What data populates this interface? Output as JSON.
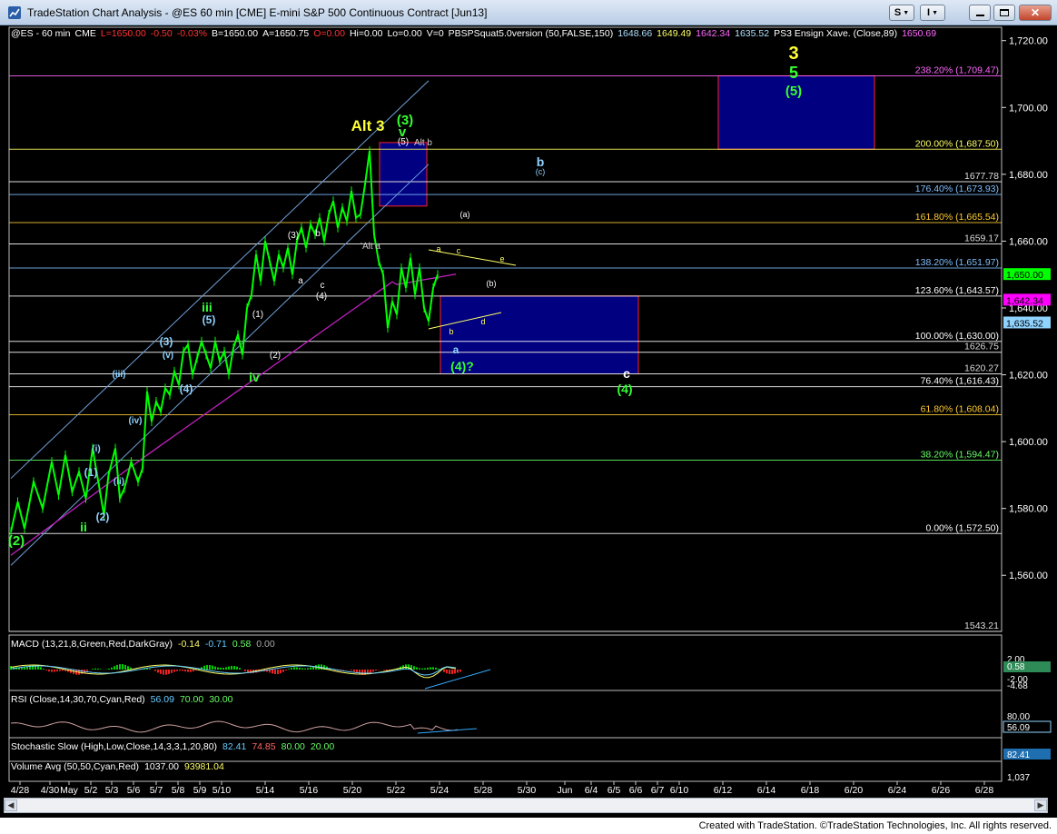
{
  "window": {
    "title": "TradeStation Chart Analysis - @ES 60 min [CME] E-mini S&P 500 Continuous Contract [Jun13]",
    "buttons": [
      "S",
      "I"
    ]
  },
  "footer": "Created with TradeStation. ©TradeStation Technologies, Inc. All rights reserved.",
  "colors": {
    "bg": "#000000",
    "price": "#00ff00",
    "box": "#000080",
    "ma": "#ff00ff",
    "channel": "#6fa0d8"
  },
  "chart_data": {
    "type": "line",
    "symbol_line": [
      {
        "t": "@ES - 60 min",
        "c": "#ffffff"
      },
      {
        "t": "CME",
        "c": "#ffffff"
      },
      {
        "t": "L=1650.00",
        "c": "#ff3333"
      },
      {
        "t": "-0.50",
        "c": "#ff3333"
      },
      {
        "t": "-0.03%",
        "c": "#ff3333"
      },
      {
        "t": "B=1650.00",
        "c": "#ffffff"
      },
      {
        "t": "A=1650.75",
        "c": "#ffffff"
      },
      {
        "t": "O=0.00",
        "c": "#ff3333"
      },
      {
        "t": "Hi=0.00",
        "c": "#ffffff"
      },
      {
        "t": "Lo=0.00",
        "c": "#ffffff"
      },
      {
        "t": "V=0",
        "c": "#ffffff"
      },
      {
        "t": "PBSPSquat5.0version (50,FALSE,150)",
        "c": "#ffffff"
      },
      {
        "t": "1648.66",
        "c": "#aee0ff"
      },
      {
        "t": "1649.49",
        "c": "#ffff66"
      },
      {
        "t": "1642.34",
        "c": "#ff66ff"
      },
      {
        "t": "1635.52",
        "c": "#aee0ff"
      },
      {
        "t": "PS3 Ensign Xave. (Close,89)",
        "c": "#ffffff"
      },
      {
        "t": "1650.69",
        "c": "#ff66ff"
      }
    ],
    "y_ticks": [
      "1,720.00",
      "1,700.00",
      "1,680.00",
      "1,660.00",
      "1,640.00",
      "1,620.00",
      "1,600.00",
      "1,580.00",
      "1,560.00"
    ],
    "y_tick_values": [
      1720,
      1700,
      1680,
      1660,
      1640,
      1620,
      1600,
      1580,
      1560
    ],
    "ylim": [
      1543.21,
      1724
    ],
    "x_labels": [
      "4/28",
      "4/30",
      "May",
      "5/2",
      "5/3",
      "5/6",
      "5/7",
      "5/8",
      "5/9",
      "5/10",
      "5/14",
      "5/16",
      "5/20",
      "5/22",
      "5/24",
      "5/28",
      "5/30",
      "Jun",
      "6/4",
      "6/5",
      "6/6",
      "6/7",
      "6/10",
      "6/12",
      "6/14",
      "6/18",
      "6/20",
      "6/24",
      "6/26",
      "6/28"
    ],
    "fib_levels": [
      {
        "label": "238.20% (1,709.47)",
        "value": 1709.47,
        "color": "#ff66ff"
      },
      {
        "label": "200.00% (1,687.50)",
        "value": 1687.5,
        "color": "#ffff66"
      },
      {
        "label": "176.40% (1,673.93)",
        "value": 1673.93,
        "color": "#7fbfff"
      },
      {
        "label": "161.80% (1,665.54)",
        "value": 1665.54,
        "color": "#ffcc33"
      },
      {
        "label": "138.20% (1,651.97)",
        "value": 1651.97,
        "color": "#7fbfff"
      },
      {
        "label": "123.60% (1,643.57)",
        "value": 1643.57,
        "color": "#ffffff"
      },
      {
        "label": "100.00% (1,630.00)",
        "value": 1630,
        "color": "#ffffff"
      },
      {
        "label": "76.40% (1,616.43)",
        "value": 1616.43,
        "color": "#ffffff"
      },
      {
        "label": "61.80% (1,608.04)",
        "value": 1608.04,
        "color": "#ffcc33"
      },
      {
        "label": "38.20% (1,594.47)",
        "value": 1594.47,
        "color": "#66ff66"
      },
      {
        "label": "0.00% (1,572.50)",
        "value": 1572.5,
        "color": "#ffffff"
      }
    ],
    "hlines": [
      {
        "label": "1677.78",
        "value": 1677.78
      },
      {
        "label": "1659.17",
        "value": 1659.17
      },
      {
        "label": "1626.75",
        "value": 1626.75
      },
      {
        "label": "1620.27",
        "value": 1620.27
      },
      {
        "label": "1543.21",
        "value": 1543.21
      }
    ],
    "price_flags": [
      {
        "label": "1,650.00",
        "value": 1650,
        "bg": "#00ff00",
        "fg": "#000000"
      },
      {
        "label": "1,642.34",
        "value": 1642.34,
        "bg": "#ff00ff",
        "fg": "#000000"
      },
      {
        "label": "1,635.52",
        "value": 1635.52,
        "bg": "#8fd3ff",
        "fg": "#000000"
      }
    ],
    "price_path": [
      [
        0,
        1573
      ],
      [
        3,
        1582
      ],
      [
        6,
        1574
      ],
      [
        10,
        1588
      ],
      [
        14,
        1580
      ],
      [
        18,
        1594
      ],
      [
        21,
        1584
      ],
      [
        24,
        1596
      ],
      [
        27,
        1585
      ],
      [
        30,
        1591
      ],
      [
        33,
        1583
      ],
      [
        36,
        1598
      ],
      [
        39,
        1586
      ],
      [
        41,
        1578
      ],
      [
        43,
        1590
      ],
      [
        46,
        1598
      ],
      [
        48,
        1583
      ],
      [
        50,
        1586
      ],
      [
        53,
        1594
      ],
      [
        56,
        1588
      ],
      [
        58,
        1592
      ],
      [
        60,
        1615
      ],
      [
        62,
        1606
      ],
      [
        64,
        1612
      ],
      [
        66,
        1609
      ],
      [
        68,
        1616
      ],
      [
        70,
        1614
      ],
      [
        72,
        1621
      ],
      [
        74,
        1617
      ],
      [
        76,
        1627
      ],
      [
        78,
        1629
      ],
      [
        80,
        1620
      ],
      [
        82,
        1625
      ],
      [
        84,
        1630
      ],
      [
        86,
        1626
      ],
      [
        88,
        1622
      ],
      [
        90,
        1630
      ],
      [
        92,
        1624
      ],
      [
        94,
        1627
      ],
      [
        96,
        1620
      ],
      [
        98,
        1628
      ],
      [
        100,
        1632
      ],
      [
        102,
        1626
      ],
      [
        104,
        1640
      ],
      [
        106,
        1644
      ],
      [
        108,
        1656
      ],
      [
        110,
        1648
      ],
      [
        112,
        1660
      ],
      [
        114,
        1654
      ],
      [
        116,
        1648
      ],
      [
        118,
        1656
      ],
      [
        120,
        1652
      ],
      [
        122,
        1658
      ],
      [
        124,
        1650
      ],
      [
        126,
        1660
      ],
      [
        128,
        1664
      ],
      [
        130,
        1658
      ],
      [
        132,
        1665
      ],
      [
        134,
        1662
      ],
      [
        136,
        1667
      ],
      [
        138,
        1660
      ],
      [
        140,
        1668
      ],
      [
        142,
        1672
      ],
      [
        144,
        1664
      ],
      [
        146,
        1670
      ],
      [
        148,
        1666
      ],
      [
        150,
        1675
      ],
      [
        152,
        1667
      ],
      [
        154,
        1668
      ],
      [
        156,
        1677
      ],
      [
        158,
        1687
      ],
      [
        160,
        1662
      ],
      [
        162,
        1654
      ],
      [
        164,
        1650
      ],
      [
        166,
        1634
      ],
      [
        168,
        1642
      ],
      [
        170,
        1638
      ],
      [
        172,
        1652
      ],
      [
        174,
        1646
      ],
      [
        176,
        1655
      ],
      [
        178,
        1644
      ],
      [
        180,
        1652
      ],
      [
        182,
        1640
      ],
      [
        184,
        1636
      ],
      [
        186,
        1646
      ],
      [
        188,
        1650
      ]
    ],
    "macd": {
      "label": "MACD (13,21,8,Green,Red,DarkGray)",
      "values": [
        "-0.14",
        "-0.71",
        "0.58",
        "0.00"
      ],
      "value_colors": [
        "#ffff66",
        "#66ccff",
        "#66ff66",
        "#aaaaaa"
      ],
      "ticks": [
        "2.00",
        "0.58",
        "-2.00",
        "-4.68"
      ]
    },
    "rsi": {
      "label": "RSI (Close,14,30,70,Cyan,Red)",
      "values": [
        "56.09",
        "70.00",
        "30.00"
      ],
      "value_colors": [
        "#66ccff",
        "#66ff66",
        "#66ff66"
      ],
      "ticks": [
        "80.00",
        "56.09"
      ]
    },
    "stoch": {
      "label": "Stochastic Slow (High,Low,Close,14,3,3,1,20,80)",
      "values": [
        "82.41",
        "74.85",
        "80.00",
        "20.00"
      ],
      "value_colors": [
        "#66ccff",
        "#ff6666",
        "#66ff66",
        "#66ff66"
      ],
      "ticks": [
        "82.41"
      ]
    },
    "volume": {
      "label": "Volume Avg (50,50,Cyan,Red)",
      "values": [
        "1037.00",
        "93981.04"
      ],
      "value_colors": [
        "#ffffff",
        "#ffff66"
      ],
      "ticks": [
        "1,037"
      ]
    },
    "annotations": [
      {
        "t": "3",
        "c": "#ffff33",
        "s": 20,
        "x": 874,
        "y": 65,
        "b": true
      },
      {
        "t": "5",
        "c": "#33ff33",
        "s": 18,
        "x": 874,
        "y": 86,
        "b": true
      },
      {
        "t": "(5)",
        "c": "#33ff33",
        "s": 15,
        "x": 874,
        "y": 105,
        "b": true
      },
      {
        "t": "Alt 3",
        "c": "#ffff33",
        "s": 17,
        "x": 405,
        "y": 144,
        "b": true
      },
      {
        "t": "(3)",
        "c": "#33ff33",
        "s": 15,
        "x": 446,
        "y": 137,
        "b": true
      },
      {
        "t": "v",
        "c": "#33ff33",
        "s": 15,
        "x": 443,
        "y": 150,
        "b": true
      },
      {
        "t": "(5)",
        "c": "#ffffff",
        "s": 10,
        "x": 444,
        "y": 159,
        "b": false
      },
      {
        "t": "Alt b",
        "c": "#cccccc",
        "s": 10,
        "x": 466,
        "y": 160,
        "b": false
      },
      {
        "t": "b",
        "c": "#8fd3ff",
        "s": 14,
        "x": 595,
        "y": 183,
        "b": true
      },
      {
        "t": "(c)",
        "c": "#8fd3ff",
        "s": 9,
        "x": 595,
        "y": 192,
        "b": false
      },
      {
        "t": "(a)",
        "c": "#ffffff",
        "s": 9,
        "x": 512,
        "y": 239,
        "b": false
      },
      {
        "t": "(b)",
        "c": "#ffffff",
        "s": 9,
        "x": 541,
        "y": 315,
        "b": false
      },
      {
        "t": "a",
        "c": "#ffff66",
        "s": 9,
        "x": 483,
        "y": 277,
        "b": false
      },
      {
        "t": "c",
        "c": "#ffff66",
        "s": 9,
        "x": 505,
        "y": 279,
        "b": false
      },
      {
        "t": "e",
        "c": "#ffff66",
        "s": 9,
        "x": 553,
        "y": 288,
        "b": false
      },
      {
        "t": "d",
        "c": "#ffff66",
        "s": 9,
        "x": 532,
        "y": 357,
        "b": false
      },
      {
        "t": "b",
        "c": "#ffff66",
        "s": 9,
        "x": 497,
        "y": 368,
        "b": false
      },
      {
        "t": "a",
        "c": "#8fd3ff",
        "s": 12,
        "x": 502,
        "y": 389,
        "b": true
      },
      {
        "t": "(4)?",
        "c": "#33ff33",
        "s": 14,
        "x": 509,
        "y": 408,
        "b": true
      },
      {
        "t": "c",
        "c": "#ffffff",
        "s": 14,
        "x": 690,
        "y": 416,
        "b": true
      },
      {
        "t": "(4)",
        "c": "#33ff33",
        "s": 14,
        "x": 688,
        "y": 433,
        "b": true
      },
      {
        "t": "(3)",
        "c": "#ffffff",
        "s": 10,
        "x": 323,
        "y": 262,
        "b": false
      },
      {
        "t": "b",
        "c": "#ffffff",
        "s": 10,
        "x": 350,
        "y": 260,
        "b": false
      },
      {
        "t": "'Alt a",
        "c": "#cccccc",
        "s": 10,
        "x": 408,
        "y": 274,
        "b": false
      },
      {
        "t": "a",
        "c": "#ffffff",
        "s": 10,
        "x": 331,
        "y": 312,
        "b": false
      },
      {
        "t": "c",
        "c": "#ffffff",
        "s": 10,
        "x": 355,
        "y": 317,
        "b": false
      },
      {
        "t": "(4)",
        "c": "#ffffff",
        "s": 10,
        "x": 354,
        "y": 329,
        "b": false
      },
      {
        "t": "(1)",
        "c": "#ffffff",
        "s": 10,
        "x": 284,
        "y": 349,
        "b": false
      },
      {
        "t": "(2)",
        "c": "#ffffff",
        "s": 10,
        "x": 303,
        "y": 394,
        "b": false
      },
      {
        "t": "iii",
        "c": "#33ff33",
        "s": 14,
        "x": 228,
        "y": 343,
        "b": true
      },
      {
        "t": "(5)",
        "c": "#8fd3ff",
        "s": 12,
        "x": 230,
        "y": 356,
        "b": true
      },
      {
        "t": "(3)",
        "c": "#8fd3ff",
        "s": 12,
        "x": 183,
        "y": 380,
        "b": true
      },
      {
        "t": "(v)",
        "c": "#8fd3ff",
        "s": 10,
        "x": 185,
        "y": 394,
        "b": true
      },
      {
        "t": "(4)",
        "c": "#8fd3ff",
        "s": 12,
        "x": 205,
        "y": 432,
        "b": true
      },
      {
        "t": "iv",
        "c": "#33ff33",
        "s": 14,
        "x": 280,
        "y": 420,
        "b": true
      },
      {
        "t": "(iii)",
        "c": "#8fd3ff",
        "s": 10,
        "x": 131,
        "y": 415,
        "b": true
      },
      {
        "t": "(iv)",
        "c": "#8fd3ff",
        "s": 10,
        "x": 149,
        "y": 466,
        "b": true
      },
      {
        "t": "(i)",
        "c": "#8fd3ff",
        "s": 10,
        "x": 106,
        "y": 497,
        "b": true
      },
      {
        "t": "(1)",
        "c": "#8fd3ff",
        "s": 12,
        "x": 100,
        "y": 524,
        "b": true
      },
      {
        "t": "(ii)",
        "c": "#8fd3ff",
        "s": 10,
        "x": 131,
        "y": 533,
        "b": true
      },
      {
        "t": "(2)",
        "c": "#8fd3ff",
        "s": 12,
        "x": 113,
        "y": 573,
        "b": true
      },
      {
        "t": "ii",
        "c": "#33ff33",
        "s": 14,
        "x": 92,
        "y": 585,
        "b": true
      },
      {
        "t": "(2)",
        "c": "#33ff33",
        "s": 15,
        "x": 18,
        "y": 600,
        "b": true
      }
    ]
  }
}
